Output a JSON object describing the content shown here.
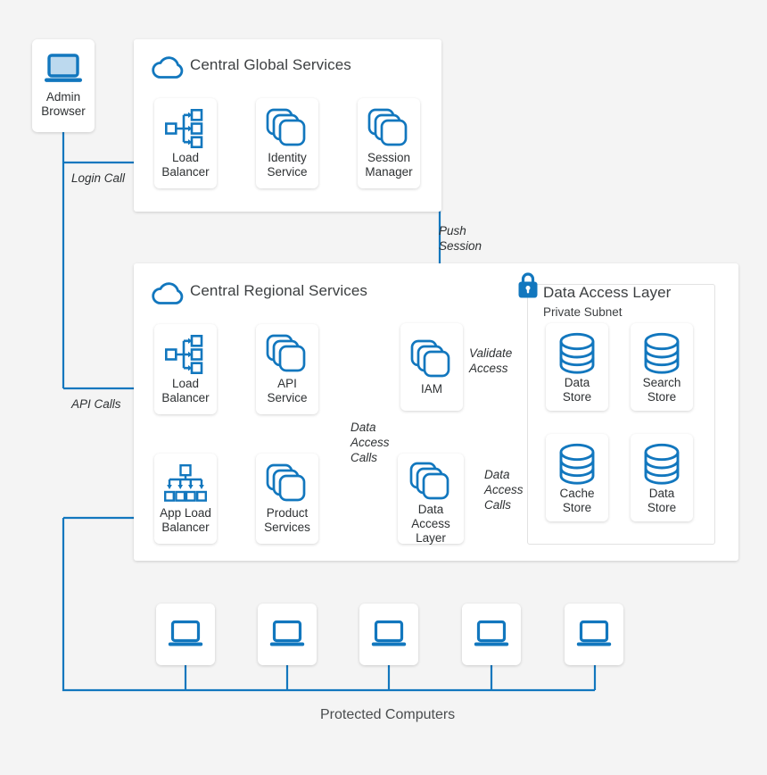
{
  "theme": {
    "background": "#f4f4f4",
    "accent": "#1277be",
    "accent_light": "#bcd9ee",
    "panel": "#ffffff",
    "text": "#2e3133",
    "title_text": "#3c3f41"
  },
  "diagram": {
    "title_bottom": "Protected Computers"
  },
  "admin": {
    "label": "Admin\nBrowser",
    "icon": "laptop-icon"
  },
  "groups": [
    {
      "id": "central-global-services",
      "title": "Central Global Services",
      "icon": "cloud-icon",
      "nodes": [
        {
          "id": "global-load-balancer",
          "label": "Load\nBalancer",
          "icon": "load-balancer-icon"
        },
        {
          "id": "identity-service",
          "label": "Identity\nService",
          "icon": "stacked-services-icon"
        },
        {
          "id": "session-manager",
          "label": "Session\nManager",
          "icon": "stacked-services-icon"
        }
      ]
    },
    {
      "id": "central-regional-services",
      "title": "Central Regional Services",
      "icon": "cloud-icon",
      "nodes": [
        {
          "id": "regional-load-balancer",
          "label": "Load\nBalancer",
          "icon": "load-balancer-icon"
        },
        {
          "id": "api-service",
          "label": "API\nService",
          "icon": "stacked-services-icon"
        },
        {
          "id": "app-load-balancer",
          "label": "App Load\nBalancer",
          "icon": "app-load-balancer-icon"
        },
        {
          "id": "product-services",
          "label": "Product\nServices",
          "icon": "stacked-services-icon"
        },
        {
          "id": "iam",
          "label": "IAM",
          "icon": "stacked-services-icon"
        },
        {
          "id": "data-access-layer-node",
          "label": "Data Access\nLayer",
          "icon": "stacked-services-icon"
        }
      ],
      "subnet": {
        "id": "data-access-layer",
        "title": "Data Access Layer",
        "subtitle": "Private Subnet",
        "icon": "lock-icon",
        "nodes": [
          {
            "id": "data-store-1",
            "label": "Data\nStore",
            "icon": "database-icon"
          },
          {
            "id": "search-store",
            "label": "Search\nStore",
            "icon": "database-icon"
          },
          {
            "id": "cache-store",
            "label": "Cache\nStore",
            "icon": "database-icon"
          },
          {
            "id": "data-store-2",
            "label": "Data\nStore",
            "icon": "database-icon"
          }
        ]
      }
    }
  ],
  "connectors": [
    {
      "id": "login-call",
      "label": "Login Call"
    },
    {
      "id": "push-session",
      "label": "Push\nSession"
    },
    {
      "id": "api-calls",
      "label": "API Calls"
    },
    {
      "id": "validate-access",
      "label": "Validate\nAccess"
    },
    {
      "id": "data-access-calls-left",
      "label": "Data\nAccess\nCalls"
    },
    {
      "id": "data-access-calls-right",
      "label": "Data\nAccess\nCalls"
    }
  ],
  "protected_computers": [
    {
      "id": "protected-computer-1",
      "icon": "laptop-icon"
    },
    {
      "id": "protected-computer-2",
      "icon": "laptop-icon"
    },
    {
      "id": "protected-computer-3",
      "icon": "laptop-icon"
    },
    {
      "id": "protected-computer-4",
      "icon": "laptop-icon"
    },
    {
      "id": "protected-computer-5",
      "icon": "laptop-icon"
    }
  ]
}
